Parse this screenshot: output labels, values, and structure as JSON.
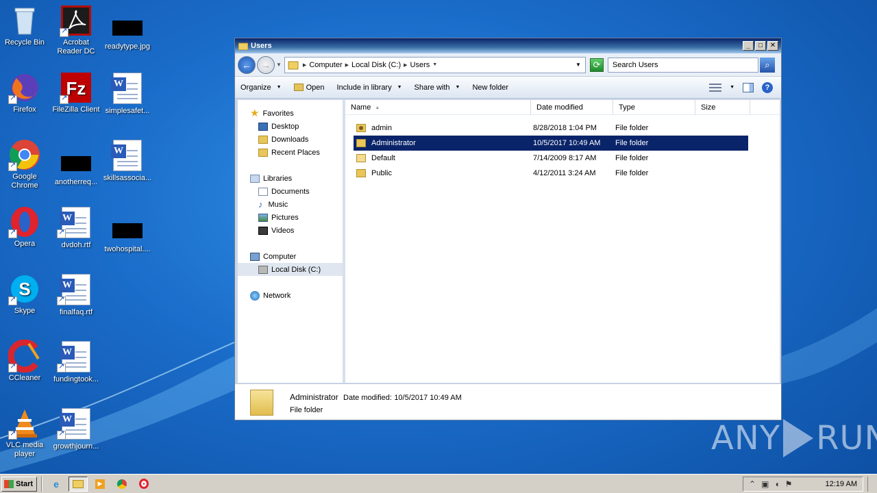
{
  "desktop": {
    "icons": [
      {
        "label": "Recycle Bin"
      },
      {
        "label": "Acrobat Reader DC"
      },
      {
        "label": "readytype.jpg"
      },
      {
        "label": "Firefox"
      },
      {
        "label": "FileZilla Client"
      },
      {
        "label": "simplesafet..."
      },
      {
        "label": "Google Chrome"
      },
      {
        "label": "anotherreq..."
      },
      {
        "label": "skillsassocia..."
      },
      {
        "label": "Opera"
      },
      {
        "label": "dvdoh.rtf"
      },
      {
        "label": "twohospital...."
      },
      {
        "label": "Skype"
      },
      {
        "label": "finalfaq.rtf"
      },
      {
        "label": "CCleaner"
      },
      {
        "label": "fundingtook..."
      },
      {
        "label": "VLC media player"
      },
      {
        "label": "growthjourn..."
      }
    ]
  },
  "window": {
    "title": "Users",
    "buttons": {
      "minimize": "_",
      "maximize": "□",
      "close": "✕"
    }
  },
  "address": {
    "crumbs": [
      "Computer",
      "Local Disk (C:)",
      "Users"
    ],
    "search_placeholder": "Search Users"
  },
  "toolbar": {
    "organize": "Organize",
    "open": "Open",
    "include": "Include in library",
    "share": "Share with",
    "newfolder": "New folder"
  },
  "navpane": {
    "favorites": "Favorites",
    "desktop": "Desktop",
    "downloads": "Downloads",
    "recent": "Recent Places",
    "libraries": "Libraries",
    "documents": "Documents",
    "music": "Music",
    "pictures": "Pictures",
    "videos": "Videos",
    "computer": "Computer",
    "localdisk": "Local Disk (C:)",
    "network": "Network"
  },
  "columns": {
    "name": "Name",
    "date": "Date modified",
    "type": "Type",
    "size": "Size"
  },
  "files": [
    {
      "name": "admin",
      "date": "8/28/2018 1:04 PM",
      "type": "File folder",
      "selected": false
    },
    {
      "name": "Administrator",
      "date": "10/5/2017 10:49 AM",
      "type": "File folder",
      "selected": true
    },
    {
      "name": "Default",
      "date": "7/14/2009 8:17 AM",
      "type": "File folder",
      "selected": false
    },
    {
      "name": "Public",
      "date": "4/12/2011 3:24 AM",
      "type": "File folder",
      "selected": false
    }
  ],
  "details": {
    "name": "Administrator",
    "date_label": "Date modified:",
    "date": "10/5/2017 10:49 AM",
    "type": "File folder"
  },
  "watermark": {
    "left": "ANY",
    "right": "RUN"
  },
  "taskbar": {
    "start": "Start",
    "clock": "12:19 AM"
  }
}
